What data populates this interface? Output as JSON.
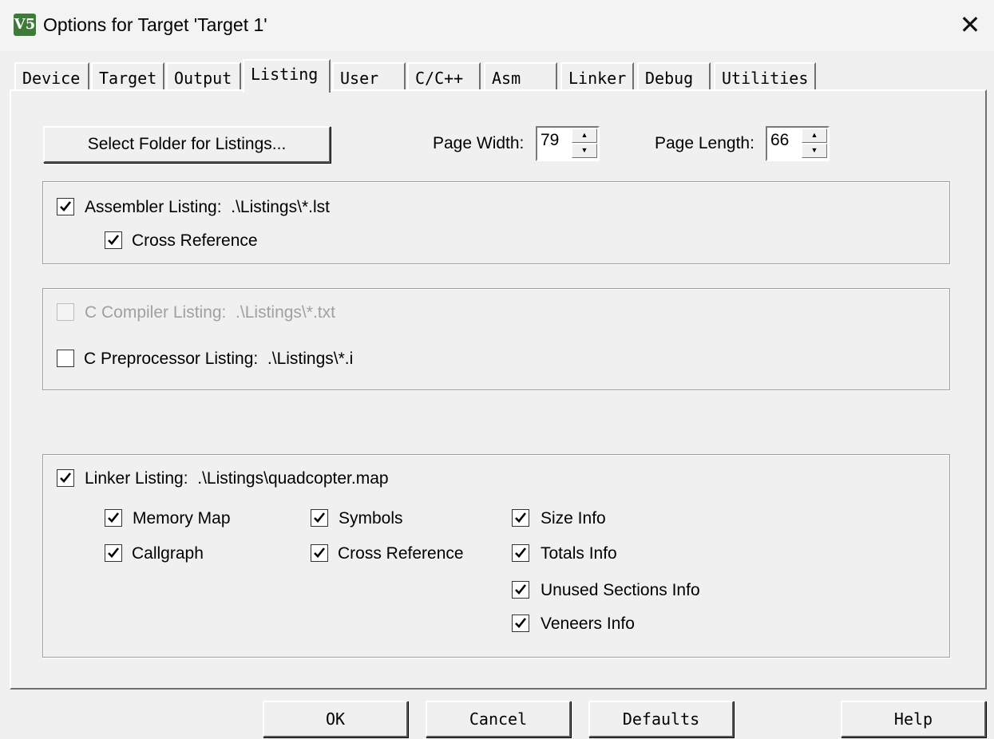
{
  "window": {
    "title": "Options for Target 'Target 1'",
    "app_icon": "V5",
    "close_glyph": "✕"
  },
  "tabs": [
    {
      "label": "Device"
    },
    {
      "label": "Target"
    },
    {
      "label": "Output"
    },
    {
      "label": "Listing",
      "active": true
    },
    {
      "label": "User"
    },
    {
      "label": "C/C++"
    },
    {
      "label": "Asm"
    },
    {
      "label": "Linker"
    },
    {
      "label": "Debug"
    },
    {
      "label": "Utilities"
    }
  ],
  "listing": {
    "select_folder_label": "Select Folder for Listings...",
    "page_width_label": "Page Width:",
    "page_width_value": "79",
    "page_length_label": "Page Length:",
    "page_length_value": "66",
    "assembler": {
      "label": "Assembler Listing:  .\\Listings\\*.lst",
      "checked": true,
      "cross_ref_label": "Cross Reference",
      "cross_ref_checked": true
    },
    "c_compiler": {
      "label": "C Compiler Listing:  .\\Listings\\*.txt",
      "checked": false,
      "enabled": false
    },
    "c_preprocessor": {
      "label": "C Preprocessor Listing:  .\\Listings\\*.i",
      "checked": false
    },
    "linker": {
      "label": "Linker Listing:  .\\Listings\\quadcopter.map",
      "checked": true,
      "options": {
        "memory_map": "Memory Map",
        "callgraph": "Callgraph",
        "symbols": "Symbols",
        "cross_reference": "Cross Reference",
        "size_info": "Size Info",
        "totals_info": "Totals Info",
        "unused_sections_info": "Unused Sections Info",
        "veneers_info": "Veneers Info"
      }
    }
  },
  "footer": {
    "ok": "OK",
    "cancel": "Cancel",
    "defaults": "Defaults",
    "help": "Help"
  }
}
